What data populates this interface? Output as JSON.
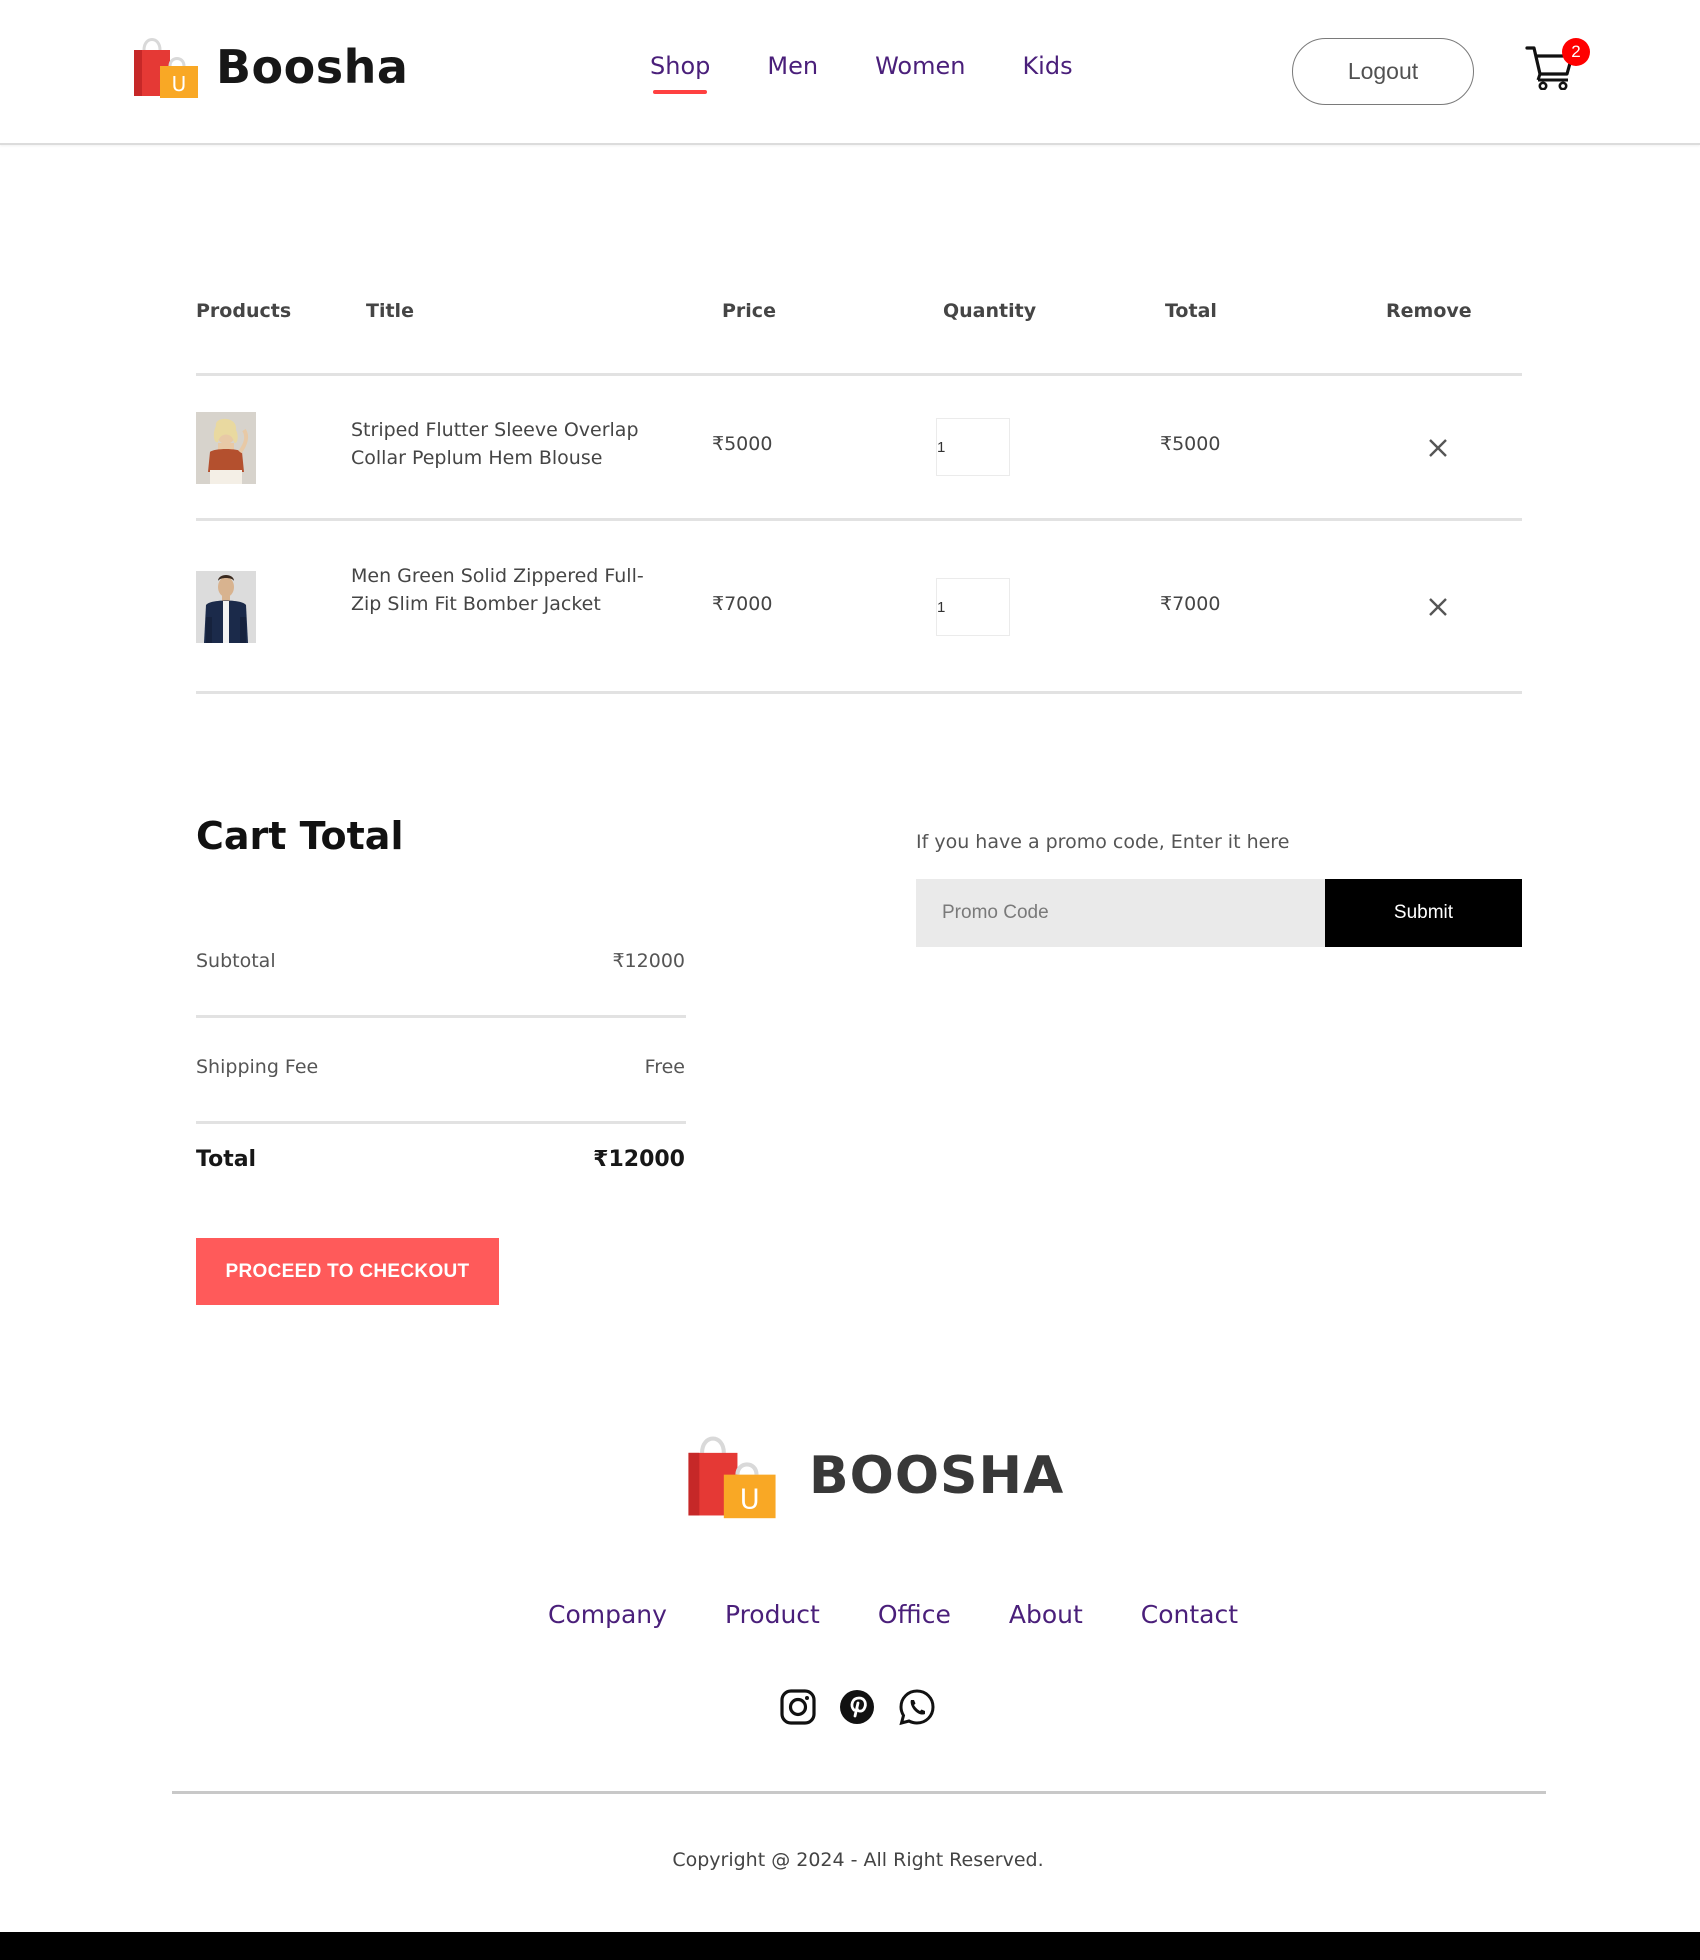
{
  "brand": {
    "name": "Boosha",
    "footer_name": "BOOSHA",
    "accent_color": "#ff4141",
    "nav_color": "#4a1f7a"
  },
  "nav": {
    "items": [
      "Shop",
      "Men",
      "Women",
      "Kids"
    ],
    "active": "Shop"
  },
  "header": {
    "logout_label": "Logout",
    "cart_count": "2",
    "cart_icon": "cart-icon"
  },
  "table": {
    "headers": [
      "Products",
      "Title",
      "Price",
      "Quantity",
      "Total",
      "Remove"
    ],
    "rows": [
      {
        "title": "Striped Flutter Sleeve Overlap Collar Peplum Hem Blouse",
        "price": "₹5000",
        "quantity": "1",
        "total": "₹5000",
        "image": "product-photo-woman-blouse"
      },
      {
        "title": "Men Green Solid Zippered Full-Zip Slim Fit Bomber Jacket",
        "price": "₹7000",
        "quantity": "1",
        "total": "₹7000",
        "image": "product-photo-man-jacket"
      }
    ]
  },
  "cart_total": {
    "title": "Cart Total",
    "subtotal_label": "Subtotal",
    "subtotal_value": "₹12000",
    "shipping_label": "Shipping Fee",
    "shipping_value": "Free",
    "total_label": "Total",
    "total_value": "₹12000",
    "checkout_label": "PROCEED TO CHECKOUT",
    "checkout_color": "#ff5a5a"
  },
  "promo": {
    "label": "If you have a promo code, Enter it here",
    "placeholder": "Promo Code",
    "value": "",
    "submit_label": "Submit"
  },
  "footer": {
    "links": [
      "Company",
      "Product",
      "Office",
      "About",
      "Contact"
    ],
    "social_icons": [
      "instagram-icon",
      "pinterest-icon",
      "whatsapp-icon"
    ],
    "copyright": "Copyright @ 2024 - All Right Reserved."
  }
}
